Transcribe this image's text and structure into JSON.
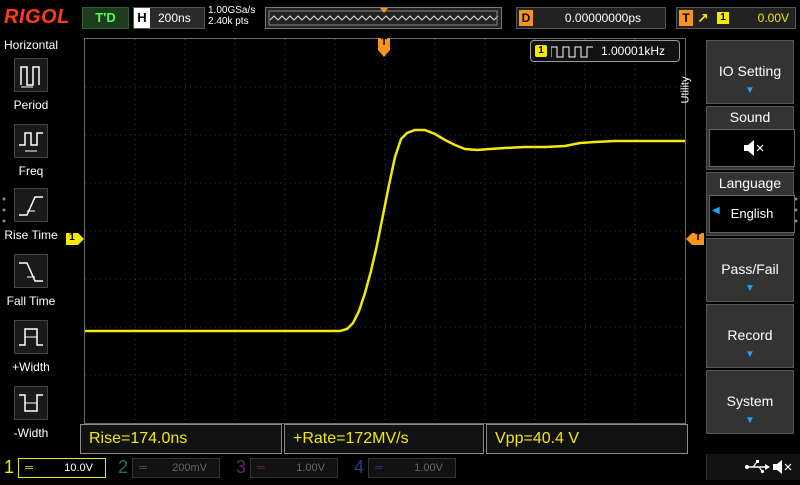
{
  "brand": "RIGOL",
  "top": {
    "trigger_state": "T'D",
    "horizontal_label": "H",
    "timebase": "200ns",
    "sample_rate": "1.00GSa/s",
    "memory_points": "2.40k pts",
    "delay_label": "D",
    "delay_value": "0.00000000ps",
    "trigger_label": "T",
    "trigger_edge_icon": "rising-edge-icon",
    "trigger_source": "1",
    "trigger_level": "0.00V"
  },
  "left_panel": {
    "title": "Horizontal",
    "items": [
      {
        "label": "Period",
        "icon": "period-icon"
      },
      {
        "label": "Freq",
        "icon": "frequency-icon"
      },
      {
        "label": "Rise Time",
        "icon": "rise-time-icon"
      },
      {
        "label": "Fall Time",
        "icon": "fall-time-icon"
      },
      {
        "label": "+Width",
        "icon": "positive-width-icon"
      },
      {
        "label": "-Width",
        "icon": "negative-width-icon"
      }
    ]
  },
  "frequency_counter": {
    "channel": "1",
    "value": "1.00001kHz"
  },
  "markers": {
    "trigger_position": "T",
    "channel1_ground": "1",
    "trigger_level": "T"
  },
  "measurements": [
    {
      "text": "Rise=174.0ns"
    },
    {
      "text": "+Rate=172MV/s"
    },
    {
      "text": "Vpp=40.4 V"
    }
  ],
  "right_menu": {
    "tab": "Utility",
    "io_setting": "IO Setting",
    "sound_title": "Sound",
    "sound_icon": "speaker-mute-icon",
    "language_title": "Language",
    "language_value": "English",
    "pass_fail": "Pass/Fail",
    "record": "Record",
    "system": "System"
  },
  "channels": [
    {
      "num": "1",
      "coupling": "═",
      "scale": "10.0V",
      "color": "#f2ea00",
      "active": true
    },
    {
      "num": "2",
      "coupling": "═",
      "scale": "200mV",
      "color": "#20c0c0",
      "active": false
    },
    {
      "num": "3",
      "coupling": "═",
      "scale": "1.00V",
      "color": "#d03ad0",
      "active": false
    },
    {
      "num": "4",
      "coupling": "═",
      "scale": "1.00V",
      "color": "#3060e0",
      "active": false
    }
  ],
  "status_icons": [
    "usb-icon",
    "speaker-mute-icon"
  ],
  "colors": {
    "ch1": "#f2ea00",
    "trigger": "#f7941d",
    "brand": "#ff3b1a",
    "accent": "#1fa3ff"
  }
}
